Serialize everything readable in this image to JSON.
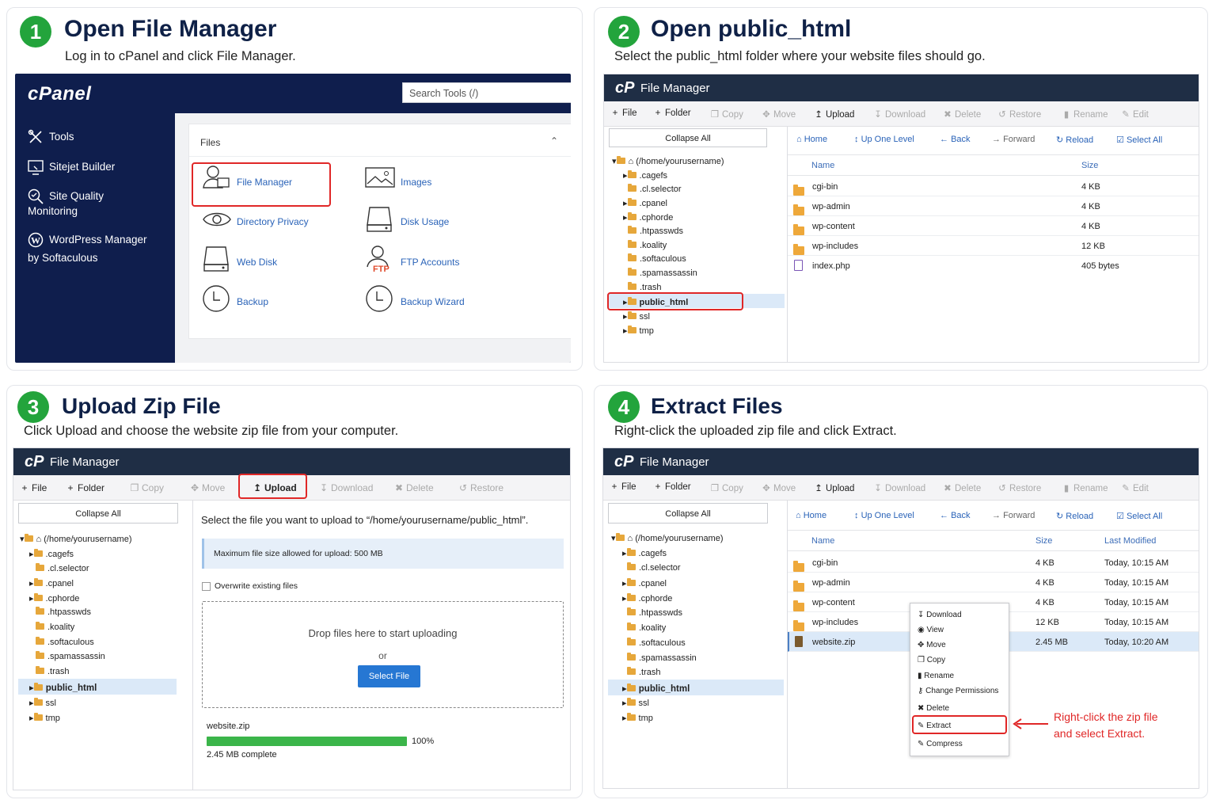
{
  "steps": [
    {
      "number": "1",
      "title": "Open File Manager",
      "subtitle": "Log in to cPanel and click File Manager."
    },
    {
      "number": "2",
      "title": "Open public_html",
      "subtitle": "Select the public_html folder where your website files should go."
    },
    {
      "number": "3",
      "title": "Upload Zip File",
      "subtitle": "Click Upload and choose the website zip file from your computer."
    },
    {
      "number": "4",
      "title": "Extract Files",
      "subtitle": "Right-click the uploaded zip file and click Extract."
    }
  ],
  "cpanel": {
    "logo": "cPanel",
    "search_placeholder": "Search Tools (/)",
    "sidebar": [
      {
        "icon": "tools-icon",
        "label": "Tools"
      },
      {
        "icon": "sitejet-icon",
        "label": "Sitejet Builder"
      },
      {
        "icon": "site-quality-icon",
        "label": "Site Quality",
        "label2": "Monitoring"
      },
      {
        "icon": "wordpress-icon",
        "label": "WordPress Manager",
        "label2": "by Softaculous"
      }
    ],
    "section_title": "Files",
    "items": [
      "File Manager",
      "Images",
      "Directory Privacy",
      "Disk Usage",
      "Web Disk",
      "FTP Accounts",
      "Backup",
      "Backup Wizard"
    ],
    "ftp_icon_text": "FTP"
  },
  "fm": {
    "logo": "cP",
    "title": "File Manager",
    "toolbar": {
      "file": "File",
      "folder": "Folder",
      "copy": "Copy",
      "move": "Move",
      "upload": "Upload",
      "download": "Download",
      "delete": "Delete",
      "restore": "Restore",
      "rename": "Rename",
      "edit": "Edit"
    },
    "collapse_all": "Collapse All",
    "nav": {
      "home": "Home",
      "up": "Up One Level",
      "back": "Back",
      "forward": "Forward",
      "reload": "Reload",
      "select_all": "Select All"
    },
    "tree_root": "(/home/yourusername)",
    "tree": [
      ".cagefs",
      ".cl.selector",
      ".cpanel",
      ".cphorde",
      ".htpasswds",
      ".koality",
      ".softaculous",
      ".spamassassin",
      ".trash",
      "public_html",
      "ssl",
      "tmp"
    ],
    "columns": {
      "name": "Name",
      "size": "Size",
      "modified": "Last Modified"
    },
    "files2": [
      {
        "name": "cgi-bin",
        "size": "4 KB"
      },
      {
        "name": "wp-admin",
        "size": "4 KB"
      },
      {
        "name": "wp-content",
        "size": "4 KB"
      },
      {
        "name": "wp-includes",
        "size": "12 KB"
      },
      {
        "name": "index.php",
        "size": "405 bytes"
      }
    ],
    "files4": [
      {
        "name": "cgi-bin",
        "size": "4 KB",
        "modified": "Today, 10:15 AM"
      },
      {
        "name": "wp-admin",
        "size": "4 KB",
        "modified": "Today, 10:15 AM"
      },
      {
        "name": "wp-content",
        "size": "4 KB",
        "modified": "Today, 10:15 AM"
      },
      {
        "name": "wp-includes",
        "size": "12 KB",
        "modified": "Today, 10:15 AM"
      },
      {
        "name": "website.zip",
        "size": "2.45 MB",
        "modified": "Today, 10:20 AM"
      }
    ]
  },
  "upload": {
    "instruction": "Select the file you want to upload to “/home/yourusername/public_html”.",
    "max_size": "Maximum file size allowed for upload: 500 MB",
    "overwrite": "Overwrite existing files",
    "drop": "Drop files here to start uploading",
    "or": "or",
    "select_button": "Select File",
    "file_name": "website.zip",
    "percent": "100%",
    "progress": 1.0,
    "complete": "2.45 MB complete"
  },
  "context_menu": [
    "Download",
    "View",
    "Move",
    "Copy",
    "Rename",
    "Change Permissions",
    "Delete",
    "Extract",
    "Compress"
  ],
  "callout": {
    "line1": "Right-click the zip file",
    "line2": "and select Extract."
  },
  "colors": {
    "accent_green": "#23a43c",
    "title_navy": "#0f2147",
    "highlight_red": "#e02727",
    "fm_header": "#1f2e45",
    "link_blue": "#2a63b8"
  }
}
